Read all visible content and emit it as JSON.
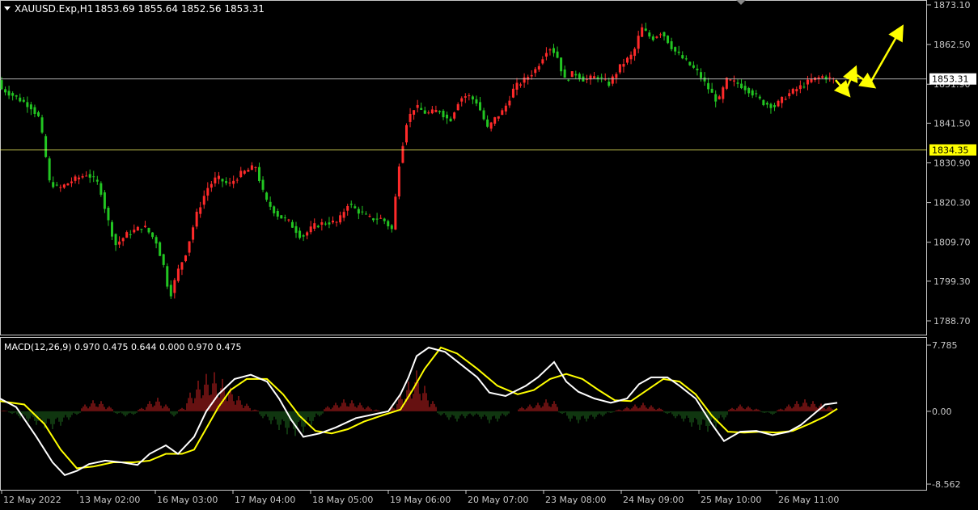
{
  "header": {
    "symbol": "XAUUSD.Exp,H1",
    "ohlc": "1853.69 1855.64 1852.56 1853.31"
  },
  "colors": {
    "background": "#000000",
    "bull": "#ff2a2a",
    "bear": "#22c522",
    "axis": "#c8c8c8",
    "macd_line": "#ffffff",
    "signal_line": "#ffff00",
    "hist_pos": "#cc2222",
    "hist_neg": "#1f6b1f",
    "level_support": "#ffff66",
    "level_current": "#c8c8c8",
    "arrows": "#ffff00"
  },
  "price_axis": {
    "ticks": [
      "1873.10",
      "1862.50",
      "1851.90",
      "1841.50",
      "1830.90",
      "1820.30",
      "1809.70",
      "1799.30",
      "1788.70"
    ]
  },
  "levels": {
    "current": "1853.31",
    "support": "1834.35"
  },
  "macd_panel": {
    "label": "MACD(12,26,9) 0.970 0.475 0.644 0.000 0.970 0.475",
    "ticks": [
      "7.785",
      "0.00",
      "-8.562"
    ]
  },
  "time_axis": {
    "labels": [
      "12 May 2022",
      "13 May 02:00",
      "16 May 03:00",
      "17 May 04:00",
      "18 May 05:00",
      "19 May 06:00",
      "20 May 07:00",
      "23 May 08:00",
      "24 May 09:00",
      "25 May 10:00",
      "26 May 11:00"
    ]
  },
  "chart_data": {
    "type": "line",
    "price_range": [
      1786,
      1875
    ],
    "macd_range": [
      -8.562,
      7.785
    ],
    "price_path": [
      [
        0,
        1851
      ],
      [
        10,
        1850
      ],
      [
        25,
        1848
      ],
      [
        40,
        1846
      ],
      [
        50,
        1843
      ],
      [
        58,
        1834
      ],
      [
        62,
        1826
      ],
      [
        75,
        1824
      ],
      [
        90,
        1826
      ],
      [
        110,
        1828
      ],
      [
        125,
        1825
      ],
      [
        135,
        1816
      ],
      [
        145,
        1809
      ],
      [
        160,
        1812
      ],
      [
        180,
        1814
      ],
      [
        195,
        1810
      ],
      [
        205,
        1803
      ],
      [
        212,
        1795
      ],
      [
        222,
        1802
      ],
      [
        232,
        1807
      ],
      [
        245,
        1817
      ],
      [
        258,
        1824
      ],
      [
        270,
        1827
      ],
      [
        285,
        1825
      ],
      [
        300,
        1828
      ],
      [
        318,
        1830
      ],
      [
        330,
        1821
      ],
      [
        345,
        1817
      ],
      [
        360,
        1815
      ],
      [
        375,
        1811
      ],
      [
        390,
        1814
      ],
      [
        405,
        1815
      ],
      [
        420,
        1815
      ],
      [
        432,
        1820
      ],
      [
        445,
        1818
      ],
      [
        460,
        1816
      ],
      [
        475,
        1816
      ],
      [
        487,
        1813
      ],
      [
        495,
        1830
      ],
      [
        505,
        1842
      ],
      [
        515,
        1846
      ],
      [
        530,
        1844
      ],
      [
        545,
        1845
      ],
      [
        558,
        1842
      ],
      [
        570,
        1848
      ],
      [
        580,
        1849
      ],
      [
        592,
        1847
      ],
      [
        605,
        1840
      ],
      [
        615,
        1843
      ],
      [
        625,
        1845
      ],
      [
        638,
        1851
      ],
      [
        650,
        1853
      ],
      [
        665,
        1856
      ],
      [
        680,
        1862
      ],
      [
        690,
        1860
      ],
      [
        700,
        1853
      ],
      [
        712,
        1855
      ],
      [
        725,
        1853
      ],
      [
        740,
        1854
      ],
      [
        755,
        1852
      ],
      [
        770,
        1857
      ],
      [
        785,
        1860
      ],
      [
        795,
        1867
      ],
      [
        808,
        1864
      ],
      [
        820,
        1866
      ],
      [
        835,
        1861
      ],
      [
        850,
        1858
      ],
      [
        865,
        1855
      ],
      [
        880,
        1850
      ],
      [
        890,
        1847
      ],
      [
        900,
        1853
      ],
      [
        915,
        1852
      ],
      [
        930,
        1850
      ],
      [
        945,
        1847
      ],
      [
        960,
        1846
      ],
      [
        975,
        1849
      ],
      [
        990,
        1851
      ],
      [
        1005,
        1853
      ],
      [
        1020,
        1854
      ],
      [
        1035,
        1853
      ]
    ],
    "macd_path": [
      [
        0,
        1.5
      ],
      [
        20,
        0.5
      ],
      [
        45,
        -3
      ],
      [
        65,
        -6
      ],
      [
        80,
        -7.5
      ],
      [
        95,
        -7
      ],
      [
        110,
        -6.2
      ],
      [
        130,
        -5.8
      ],
      [
        150,
        -6
      ],
      [
        170,
        -6.3
      ],
      [
        185,
        -5
      ],
      [
        205,
        -4
      ],
      [
        220,
        -5
      ],
      [
        240,
        -3
      ],
      [
        255,
        0
      ],
      [
        270,
        2
      ],
      [
        290,
        3.8
      ],
      [
        310,
        4.3
      ],
      [
        330,
        3.5
      ],
      [
        345,
        1.5
      ],
      [
        360,
        -1
      ],
      [
        375,
        -3
      ],
      [
        395,
        -2.6
      ],
      [
        415,
        -1.9
      ],
      [
        440,
        -0.8
      ],
      [
        460,
        -0.4
      ],
      [
        480,
        0
      ],
      [
        495,
        2
      ],
      [
        505,
        4
      ],
      [
        515,
        6.5
      ],
      [
        530,
        7.5
      ],
      [
        550,
        7
      ],
      [
        570,
        5.5
      ],
      [
        590,
        4
      ],
      [
        605,
        2.2
      ],
      [
        625,
        1.8
      ],
      [
        650,
        3
      ],
      [
        665,
        4
      ],
      [
        685,
        5.8
      ],
      [
        700,
        3.5
      ],
      [
        715,
        2.3
      ],
      [
        735,
        1.5
      ],
      [
        755,
        1
      ],
      [
        775,
        1.5
      ],
      [
        790,
        3.2
      ],
      [
        805,
        4
      ],
      [
        825,
        4
      ],
      [
        840,
        3
      ],
      [
        860,
        1.5
      ],
      [
        880,
        -1.5
      ],
      [
        895,
        -3.5
      ],
      [
        915,
        -2.4
      ],
      [
        935,
        -2.3
      ],
      [
        955,
        -2.8
      ],
      [
        975,
        -2.4
      ],
      [
        990,
        -1.6
      ],
      [
        1005,
        -0.4
      ],
      [
        1020,
        0.8
      ],
      [
        1035,
        1
      ]
    ],
    "signal_path": [
      [
        0,
        1.2
      ],
      [
        30,
        0.8
      ],
      [
        55,
        -1.5
      ],
      [
        75,
        -4.5
      ],
      [
        95,
        -6.7
      ],
      [
        115,
        -6.5
      ],
      [
        140,
        -6
      ],
      [
        165,
        -6
      ],
      [
        185,
        -5.8
      ],
      [
        205,
        -5
      ],
      [
        225,
        -5
      ],
      [
        240,
        -4.5
      ],
      [
        255,
        -2
      ],
      [
        270,
        0.5
      ],
      [
        285,
        2.5
      ],
      [
        305,
        3.8
      ],
      [
        330,
        3.8
      ],
      [
        350,
        2
      ],
      [
        370,
        -0.5
      ],
      [
        390,
        -2.3
      ],
      [
        410,
        -2.6
      ],
      [
        430,
        -2.1
      ],
      [
        450,
        -1.2
      ],
      [
        475,
        -0.4
      ],
      [
        495,
        0.2
      ],
      [
        510,
        2.5
      ],
      [
        525,
        5
      ],
      [
        545,
        7.5
      ],
      [
        565,
        6.8
      ],
      [
        590,
        5
      ],
      [
        615,
        3
      ],
      [
        640,
        2
      ],
      [
        660,
        2.5
      ],
      [
        680,
        3.8
      ],
      [
        700,
        4.4
      ],
      [
        720,
        3.8
      ],
      [
        740,
        2.5
      ],
      [
        760,
        1.3
      ],
      [
        780,
        1.2
      ],
      [
        800,
        2.5
      ],
      [
        820,
        3.8
      ],
      [
        840,
        3.5
      ],
      [
        860,
        2
      ],
      [
        880,
        -0.5
      ],
      [
        900,
        -2.4
      ],
      [
        920,
        -2.5
      ],
      [
        940,
        -2.4
      ],
      [
        960,
        -2.5
      ],
      [
        980,
        -2.3
      ],
      [
        1000,
        -1.5
      ],
      [
        1020,
        -0.6
      ],
      [
        1035,
        0.3
      ]
    ],
    "histogram": [
      [
        5,
        0.1
      ],
      [
        15,
        -0.3
      ],
      [
        25,
        -0.8
      ],
      [
        35,
        -1.2
      ],
      [
        45,
        -1.6
      ],
      [
        55,
        -2
      ],
      [
        65,
        -2.1
      ],
      [
        75,
        -1.7
      ],
      [
        85,
        -1.0
      ],
      [
        95,
        -0.4
      ],
      [
        105,
        0.8
      ],
      [
        115,
        1.3
      ],
      [
        125,
        1.2
      ],
      [
        135,
        0.6
      ],
      [
        145,
        -0.3
      ],
      [
        155,
        -0.6
      ],
      [
        165,
        -0.4
      ],
      [
        175,
        0.4
      ],
      [
        185,
        1.2
      ],
      [
        195,
        1.6
      ],
      [
        205,
        0.8
      ],
      [
        215,
        -0.6
      ],
      [
        225,
        0.4
      ],
      [
        235,
        2.2
      ],
      [
        245,
        3.6
      ],
      [
        255,
        4.4
      ],
      [
        265,
        4.6
      ],
      [
        275,
        3.8
      ],
      [
        285,
        2.8
      ],
      [
        295,
        1.8
      ],
      [
        305,
        0.9
      ],
      [
        315,
        0.2
      ],
      [
        325,
        -0.8
      ],
      [
        335,
        -1.5
      ],
      [
        345,
        -2.2
      ],
      [
        355,
        -2.7
      ],
      [
        365,
        -2.9
      ],
      [
        375,
        -2.5
      ],
      [
        385,
        -1.6
      ],
      [
        395,
        -0.6
      ],
      [
        405,
        0.6
      ],
      [
        415,
        1
      ],
      [
        425,
        1.4
      ],
      [
        435,
        1.3
      ],
      [
        445,
        1
      ],
      [
        455,
        0.6
      ],
      [
        465,
        0.2
      ],
      [
        475,
        -0.1
      ],
      [
        485,
        0.5
      ],
      [
        495,
        2
      ],
      [
        505,
        3.5
      ],
      [
        515,
        4.8
      ],
      [
        525,
        3
      ],
      [
        535,
        1.2
      ],
      [
        545,
        -0.5
      ],
      [
        555,
        -1
      ],
      [
        565,
        -1.2
      ],
      [
        575,
        -0.8
      ],
      [
        585,
        -0.6
      ],
      [
        595,
        -0.9
      ],
      [
        605,
        -1.4
      ],
      [
        615,
        -1.2
      ],
      [
        625,
        -0.6
      ],
      [
        635,
        0
      ],
      [
        645,
        0.5
      ],
      [
        655,
        0.8
      ],
      [
        665,
        1
      ],
      [
        675,
        1.4
      ],
      [
        685,
        1.2
      ],
      [
        695,
        -0.3
      ],
      [
        705,
        -1.2
      ],
      [
        715,
        -1.4
      ],
      [
        725,
        -1.2
      ],
      [
        735,
        -0.9
      ],
      [
        745,
        -0.6
      ],
      [
        755,
        -0.2
      ],
      [
        765,
        0.2
      ],
      [
        775,
        0.5
      ],
      [
        785,
        0.8
      ],
      [
        795,
        1
      ],
      [
        805,
        0.7
      ],
      [
        815,
        0.4
      ],
      [
        825,
        -0.3
      ],
      [
        835,
        -0.8
      ],
      [
        845,
        -1.2
      ],
      [
        855,
        -1.8
      ],
      [
        865,
        -2.2
      ],
      [
        875,
        -2.4
      ],
      [
        885,
        -1.9
      ],
      [
        895,
        -1
      ],
      [
        905,
        0.4
      ],
      [
        915,
        0.8
      ],
      [
        925,
        0.6
      ],
      [
        935,
        0.3
      ],
      [
        945,
        -0.2
      ],
      [
        955,
        -0.4
      ],
      [
        965,
        0.3
      ],
      [
        975,
        0.8
      ],
      [
        985,
        1.2
      ],
      [
        995,
        1.4
      ],
      [
        1005,
        1.2
      ],
      [
        1015,
        0.9
      ],
      [
        1025,
        0.6
      ]
    ],
    "arrow_path": [
      [
        1033,
        1853
      ],
      [
        1045,
        1850
      ],
      [
        1055,
        1855
      ],
      [
        1075,
        1852
      ],
      [
        1112,
        1866
      ]
    ]
  }
}
